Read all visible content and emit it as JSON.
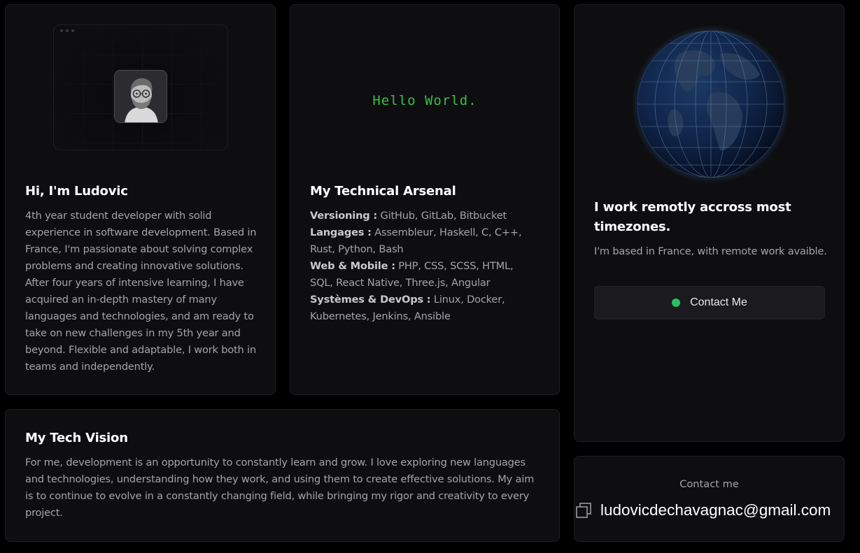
{
  "about": {
    "title": "Hi, I'm Ludovic",
    "bio": "4th year student developer with solid experience in software development. Based in France, I'm passionate about solving complex problems and creating innovative solutions. After four years of intensive learning, I have acquired an in-depth mastery of many languages and technologies, and am ready to take on new challenges in my 5th year and beyond. Flexible and adaptable, I work both in teams and independently."
  },
  "tech": {
    "hello": "Hello World.",
    "title": "My Technical Arsenal",
    "stacks": [
      {
        "label": "Versioning :",
        "value": " GitHub, GitLab, Bitbucket"
      },
      {
        "label": "Langages :",
        "value": " Assembleur, Haskell, C, C++, Rust, Python, Bash"
      },
      {
        "label": "Web & Mobile :",
        "value": " PHP, CSS, SCSS, HTML, SQL, React Native, Three.js, Angular"
      },
      {
        "label": "Systèmes & DevOps :",
        "value": " Linux, Docker, Kubernetes, Jenkins, Ansible"
      }
    ]
  },
  "remote": {
    "title": "I work remotly accross most timezones.",
    "subtitle": "I'm based in France, with remote work avaible.",
    "button_label": "Contact Me",
    "status_color": "#22c55e"
  },
  "vision": {
    "title": "My Tech Vision",
    "text": "For me, development is an opportunity to constantly learn and grow. I love exploring new languages and technologies, understanding how they work, and using them to create effective solutions. My aim is to continue to evolve in a constantly changing field, while bringing my rigor and creativity to every project."
  },
  "contact": {
    "label": "Contact me",
    "email": "ludovicdechavagnac@gmail.com",
    "copy_icon": "copy-icon"
  }
}
